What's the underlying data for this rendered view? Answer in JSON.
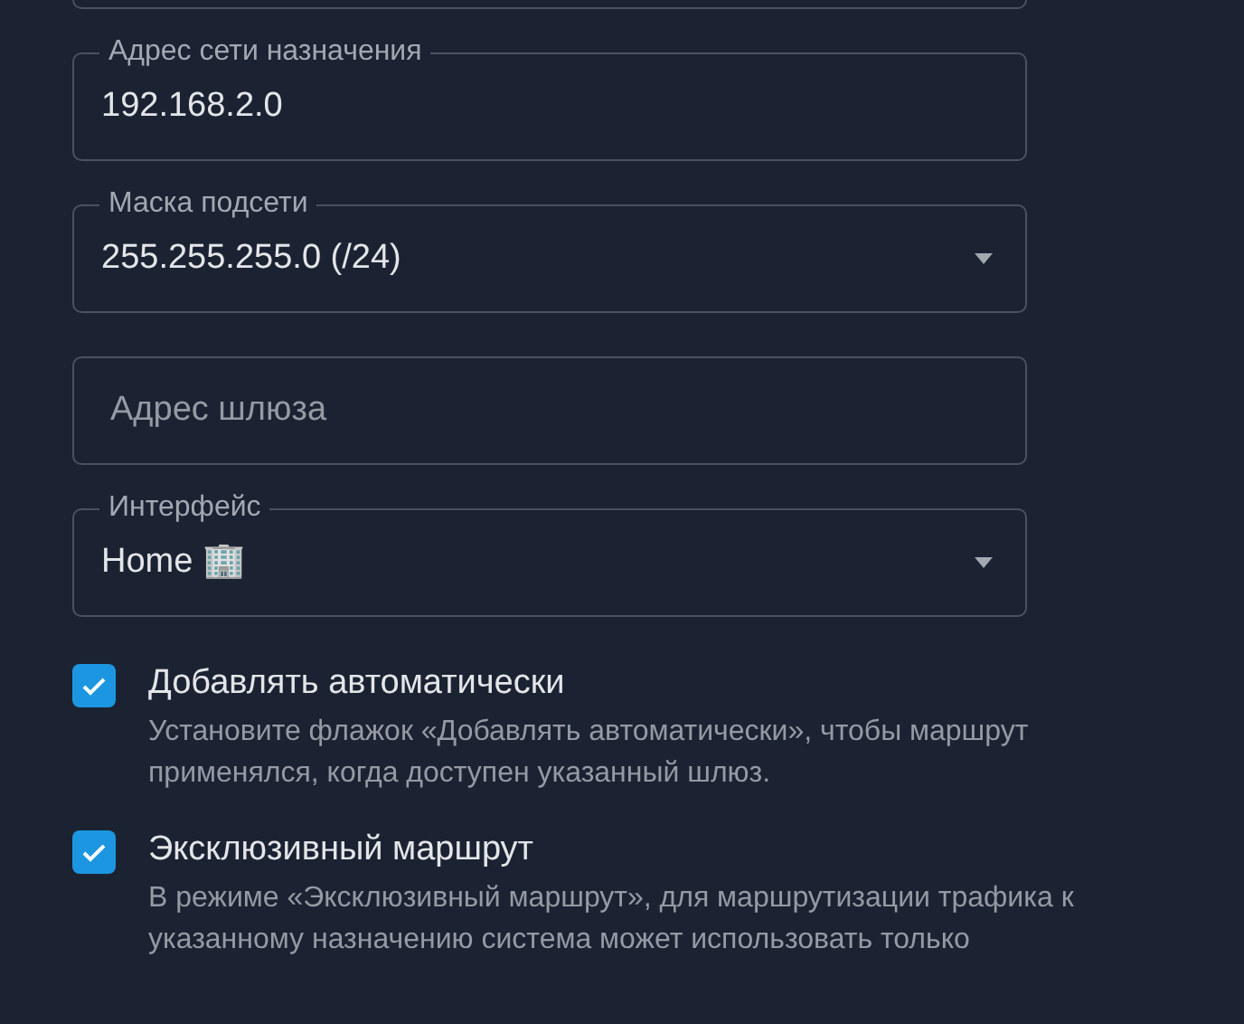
{
  "fields": [
    {
      "kind": "text",
      "label": "Адрес сети назначения",
      "value": "192.168.2.0"
    },
    {
      "kind": "select",
      "label": "Маска подсети",
      "value": "255.255.255.0 (/24)"
    },
    {
      "kind": "text",
      "placeholder": "Адрес шлюза"
    },
    {
      "kind": "select",
      "label": "Интерфейс",
      "value": "Home 🏢"
    }
  ],
  "options": [
    {
      "label": "Добавлять автоматически",
      "checked": true,
      "description": "Установите флажок «Добавлять автоматически», чтобы маршрут применялся, когда доступен указанный шлюз."
    },
    {
      "label": "Эксклюзивный маршрут",
      "checked": true,
      "description": "В режиме «Эксклюзивный маршрут», для маршрутизации трафика к указанному назначению система может использовать только"
    }
  ]
}
